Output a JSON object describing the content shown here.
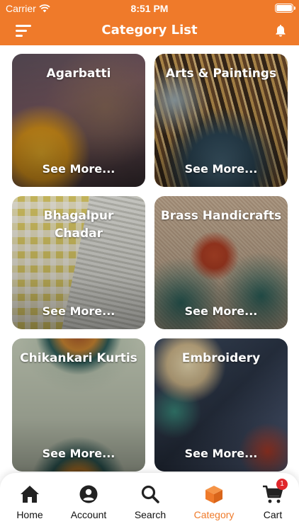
{
  "status_bar": {
    "carrier": "Carrier",
    "time": "8:51 PM"
  },
  "header": {
    "title": "Category List",
    "menu_icon": "menu-icon",
    "bell_icon": "bell-icon"
  },
  "categories": [
    {
      "name": "Agarbatti",
      "more": "See More..."
    },
    {
      "name": "Arts & Paintings",
      "more": "See More..."
    },
    {
      "name": "Bhagalpur Chadar",
      "more": "See More..."
    },
    {
      "name": "Brass Handicrafts",
      "more": "See More..."
    },
    {
      "name": "Chikankari Kurtis",
      "more": "See More..."
    },
    {
      "name": "Embroidery",
      "more": "See More..."
    }
  ],
  "bottom_nav": {
    "items": [
      {
        "label": "Home",
        "icon": "home-icon"
      },
      {
        "label": "Account",
        "icon": "account-icon"
      },
      {
        "label": "Search",
        "icon": "search-icon"
      },
      {
        "label": "Category",
        "icon": "category-box-icon"
      },
      {
        "label": "Cart",
        "icon": "cart-icon"
      }
    ],
    "active": "Category",
    "cart_badge": "1"
  },
  "colors": {
    "accent": "#ef7a2a",
    "badge": "#e0262b"
  }
}
